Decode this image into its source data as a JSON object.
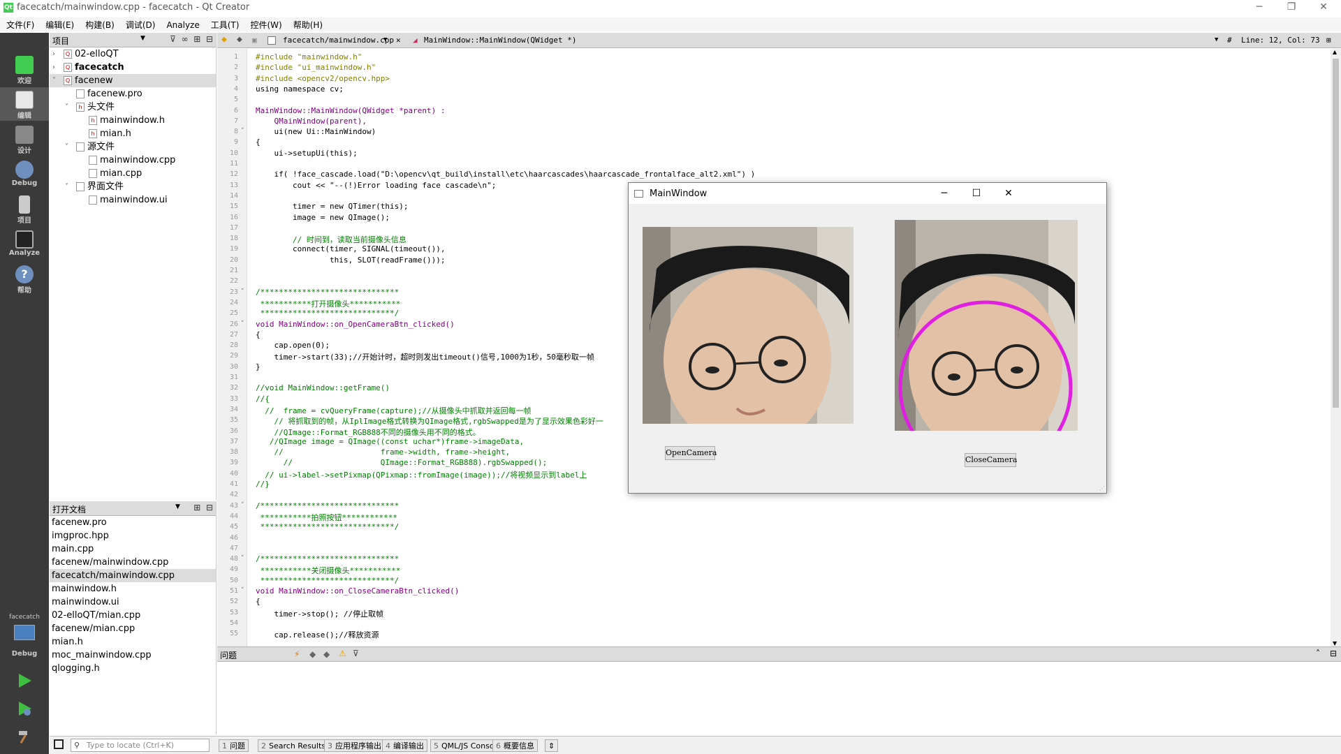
{
  "window": {
    "title": "facecatch/mainwindow.cpp - facecatch - Qt Creator",
    "icon_text": "Qt"
  },
  "menu": [
    "文件(F)",
    "编辑(E)",
    "构建(B)",
    "调试(D)",
    "Analyze",
    "工具(T)",
    "控件(W)",
    "帮助(H)"
  ],
  "modes": [
    {
      "label": "欢迎",
      "icon": "qt-logo-icon",
      "color": "#41cd52"
    },
    {
      "label": "编辑",
      "icon": "edit-document-icon",
      "color": "#e8e8e8"
    },
    {
      "label": "设计",
      "icon": "design-pen-icon",
      "color": "#bbbbbb"
    },
    {
      "label": "Debug",
      "icon": "debug-bug-icon",
      "color": "#6f8fbf"
    },
    {
      "label": "项目",
      "icon": "project-wrench-icon",
      "color": "#cccccc"
    },
    {
      "label": "Analyze",
      "icon": "analyze-monitor-icon",
      "color": "#555555"
    },
    {
      "label": "帮助",
      "icon": "help-icon",
      "color": "#6f8fbf"
    }
  ],
  "kit": {
    "project": "facecatch",
    "config": "Debug"
  },
  "project_pane": {
    "title": "项目",
    "tree": [
      {
        "label": "02-elloQT",
        "depth": 0,
        "arrow": "›",
        "icon": "Qt",
        "bold": false,
        "sel": false
      },
      {
        "label": "facecatch",
        "depth": 0,
        "arrow": "›",
        "icon": "Qt",
        "bold": true,
        "sel": false
      },
      {
        "label": "facenew",
        "depth": 0,
        "arrow": "˅",
        "icon": "Qt",
        "bold": false,
        "sel": true
      },
      {
        "label": "facenew.pro",
        "depth": 1,
        "arrow": "",
        "icon": "pro",
        "bold": false,
        "sel": false
      },
      {
        "label": "头文件",
        "depth": 1,
        "arrow": "˅",
        "icon": "h",
        "bold": false,
        "sel": false
      },
      {
        "label": "mainwindow.h",
        "depth": 2,
        "arrow": "",
        "icon": "h",
        "bold": false,
        "sel": false
      },
      {
        "label": "mian.h",
        "depth": 2,
        "arrow": "",
        "icon": "h",
        "bold": false,
        "sel": false
      },
      {
        "label": "源文件",
        "depth": 1,
        "arrow": "˅",
        "icon": "c++",
        "bold": false,
        "sel": false
      },
      {
        "label": "mainwindow.cpp",
        "depth": 2,
        "arrow": "",
        "icon": "c++",
        "bold": false,
        "sel": false
      },
      {
        "label": "mian.cpp",
        "depth": 2,
        "arrow": "",
        "icon": "c++",
        "bold": false,
        "sel": false
      },
      {
        "label": "界面文件",
        "depth": 1,
        "arrow": "˅",
        "icon": "ui",
        "bold": false,
        "sel": false
      },
      {
        "label": "mainwindow.ui",
        "depth": 2,
        "arrow": "",
        "icon": "ui",
        "bold": false,
        "sel": false
      }
    ]
  },
  "open_docs": {
    "title": "打开文档",
    "items": [
      "facenew.pro",
      "imgproc.hpp",
      "main.cpp",
      "facenew/mainwindow.cpp",
      "facecatch/mainwindow.cpp",
      "mainwindow.h",
      "mainwindow.ui",
      "02-elloQT/mian.cpp",
      "facenew/mian.cpp",
      "mian.h",
      "moc_mainwindow.cpp",
      "qlogging.h"
    ],
    "selected": 4
  },
  "editor_toolbar": {
    "file": "facecatch/mainwindow.cpp",
    "symbol": "MainWindow::MainWindow(QWidget *)",
    "position": "Line: 12, Col: 73"
  },
  "code_lines": [
    "#include \"mainwindow.h\"",
    "#include \"ui_mainwindow.h\"",
    "#include <opencv2/opencv.hpp>",
    "using namespace cv;",
    "",
    "MainWindow::MainWindow(QWidget *parent) :",
    "    QMainWindow(parent),",
    "    ui(new Ui::MainWindow)",
    "{",
    "    ui->setupUi(this);",
    "",
    "    if( !face_cascade.load(\"D:\\opencv\\qt_build\\install\\etc\\haarcascades\\haarcascade_frontalface_alt2.xml\") )",
    "        cout << \"--(!)Error loading face cascade\\n\";",
    "",
    "        timer = new QTimer(this);",
    "        image = new QImage();",
    "",
    "        // 时间到，读取当前摄像头信息",
    "        connect(timer, SIGNAL(timeout()),",
    "                this, SLOT(readFrame()));",
    "",
    "",
    "/******************************",
    " ***********打开摄像头***********",
    " *****************************/",
    "void MainWindow::on_OpenCameraBtn_clicked()",
    "{",
    "    cap.open(0);",
    "    timer->start(33);//开始计时，超时则发出timeout()信号,1000为1秒，50毫秒取一帧",
    "}",
    "",
    "//void MainWindow::getFrame()",
    "//{",
    "  //  frame = cvQueryFrame(capture);//从摄像头中抓取并返回每一帧",
    "    // 将抓取到的帧，从IplImage格式转换为QImage格式,rgbSwapped是为了显示效果色彩好一",
    "    //QImage::Format_RGB888不同的摄像头用不同的格式。",
    "   //QImage image = QImage((const uchar*)frame->imageData,",
    "    //                     frame->width, frame->height,",
    "      //                   QImage::Format_RGB888).rgbSwapped();",
    "  // ui->label->setPixmap(QPixmap::fromImage(image));//将视频显示到label上",
    "//}",
    "",
    "/******************************",
    " ***********拍照按钮************",
    " *****************************/",
    "",
    "",
    "/******************************",
    " ***********关闭摄像头***********",
    " *****************************/",
    "void MainWindow::on_CloseCameraBtn_clicked()",
    "{",
    "    timer->stop(); //停止取帧",
    "",
    "    cap.release();//释放资源"
  ],
  "output_pane": {
    "title": "问题"
  },
  "status_tabs": [
    {
      "num": "1",
      "label": "问题"
    },
    {
      "num": "2",
      "label": "Search Results"
    },
    {
      "num": "3",
      "label": "应用程序输出"
    },
    {
      "num": "4",
      "label": "编译输出"
    },
    {
      "num": "5",
      "label": "QML/JS Console"
    },
    {
      "num": "6",
      "label": "概要信息"
    }
  ],
  "locate_placeholder": "Type to locate (Ctrl+K)",
  "app_window": {
    "title": "MainWindow",
    "open_btn": "OpenCamera",
    "close_btn": "CloseCamera"
  },
  "colors": {
    "sidebar": "#3a3a3a",
    "keyword": "#808000",
    "type": "#800080",
    "string": "#008000",
    "comment": "#008000",
    "face_circle": "#e020e0"
  }
}
